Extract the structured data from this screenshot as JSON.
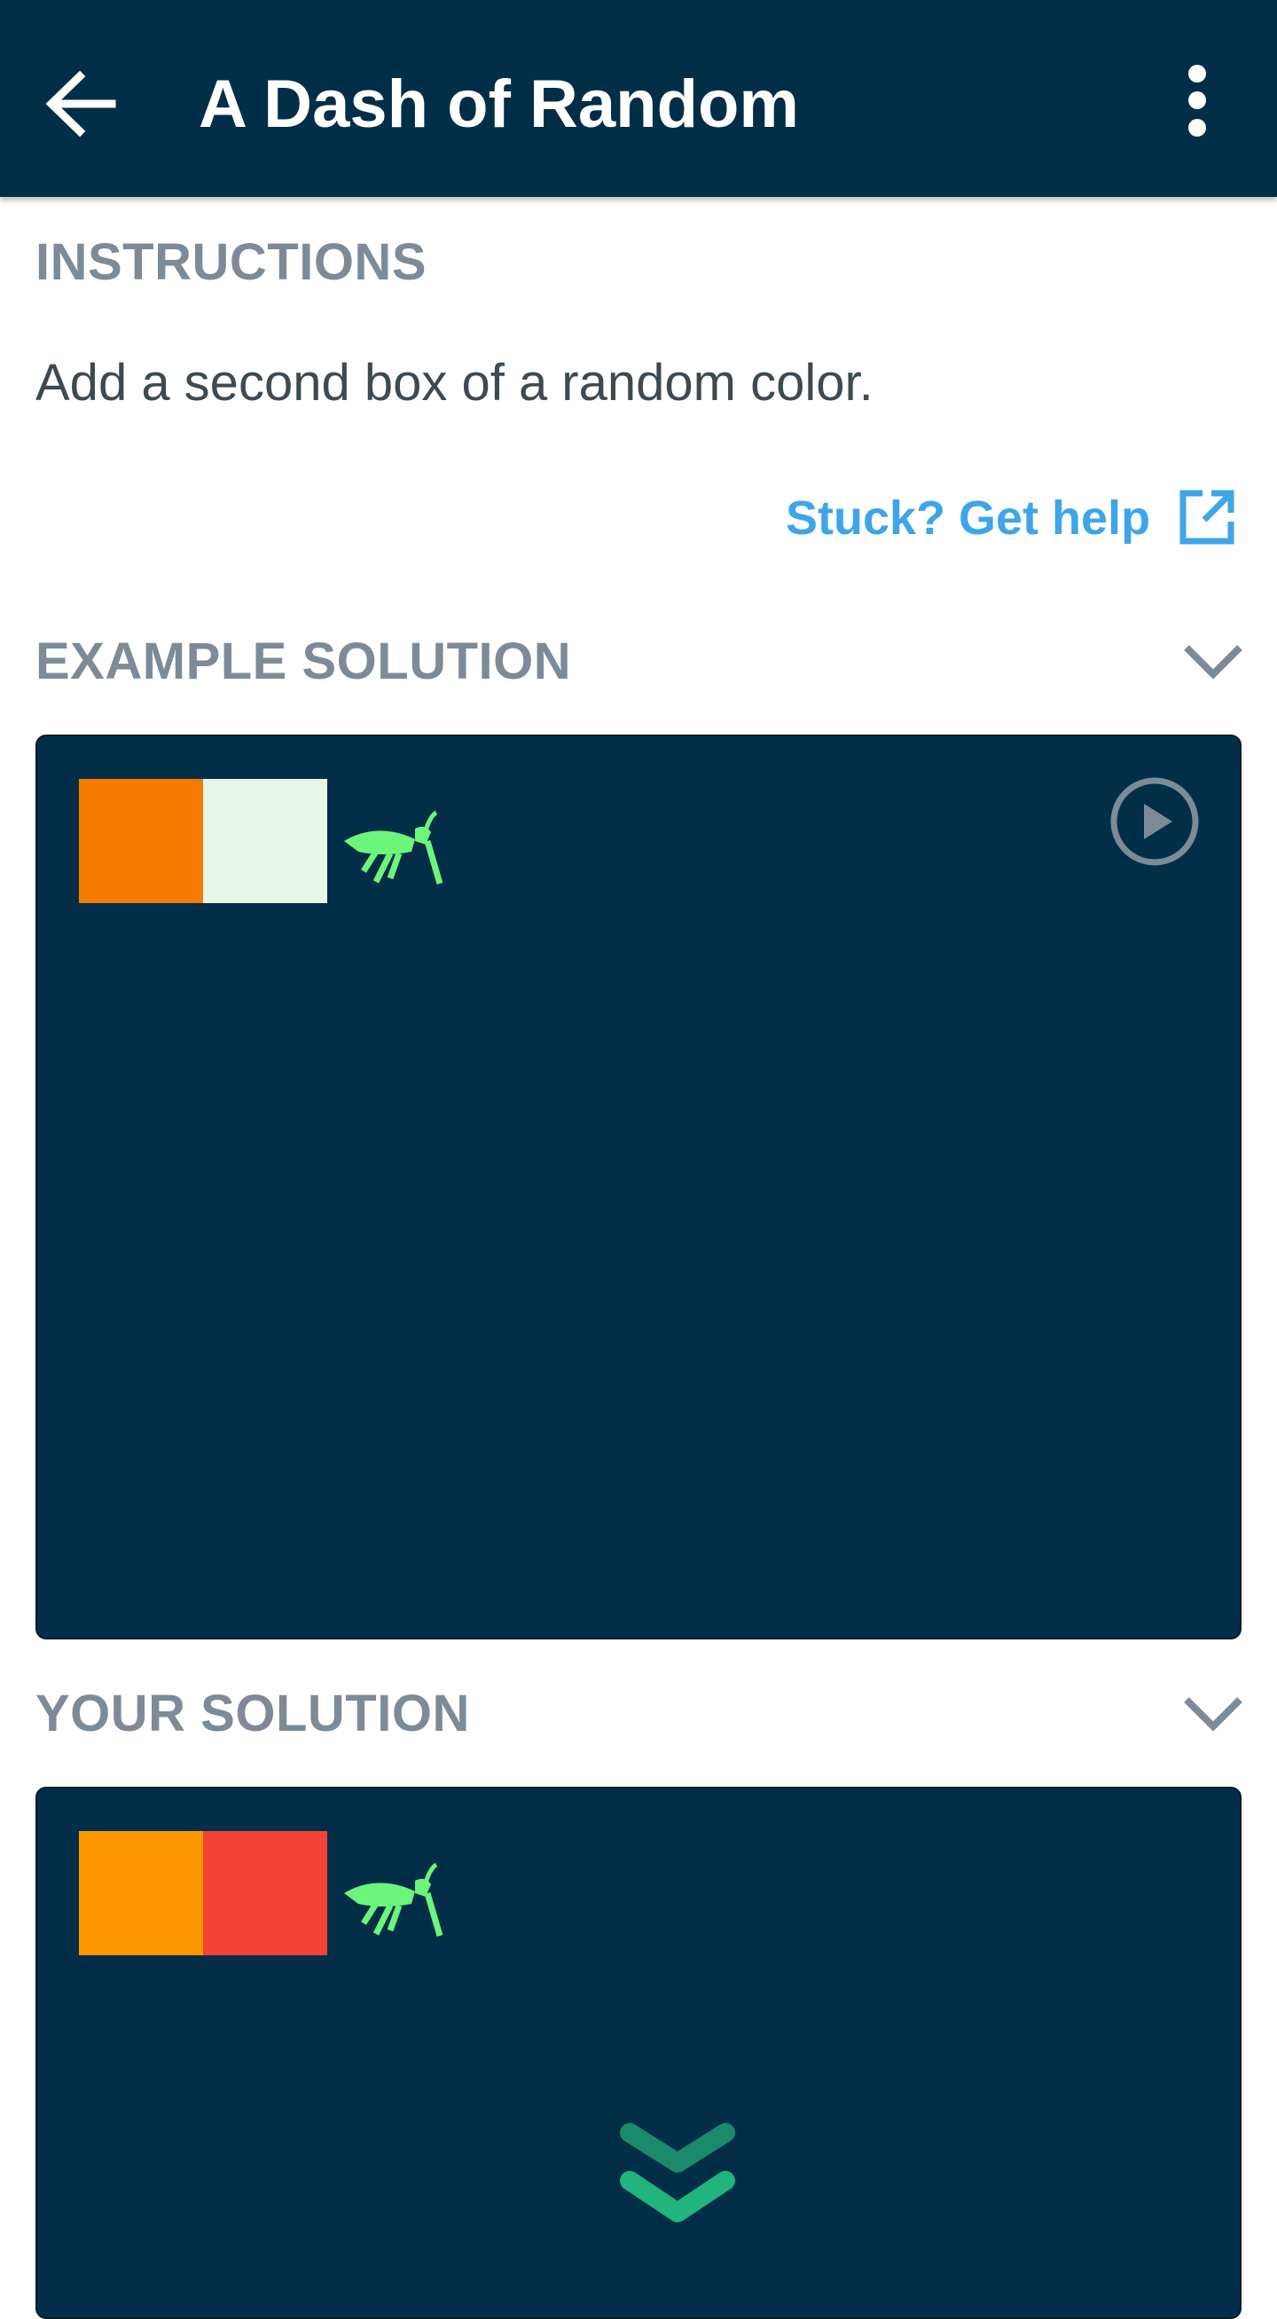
{
  "app_bar": {
    "title": "A Dash of Random",
    "back_icon": "arrow-back-icon",
    "more_icon": "more-vert-icon",
    "background": "#022e48"
  },
  "instructions": {
    "heading": "INSTRUCTIONS",
    "text": "Add a second box of a random color.",
    "help_link": "Stuck? Get help",
    "help_icon": "open-external-icon"
  },
  "example_solution": {
    "heading": "EXAMPLE SOLUTION",
    "collapse_icon": "chevron-down-icon",
    "boxes": [
      "#f57c00",
      "#e8f5e9"
    ],
    "bug_icon": "grasshopper-icon",
    "play_icon": "play-circle-icon"
  },
  "your_solution": {
    "heading": "YOUR SOLUTION",
    "collapse_icon": "chevron-down-icon",
    "boxes": [
      "#ff9800",
      "#f44336"
    ],
    "bug_icon": "grasshopper-icon",
    "scroll_icon": "double-chevron-down-icon"
  },
  "colors": {
    "accent_link": "#3fa4ea",
    "heading_gray": "#7c8b97",
    "bug_green": "#6cf57a",
    "scroll_green": "#1fb57d"
  }
}
